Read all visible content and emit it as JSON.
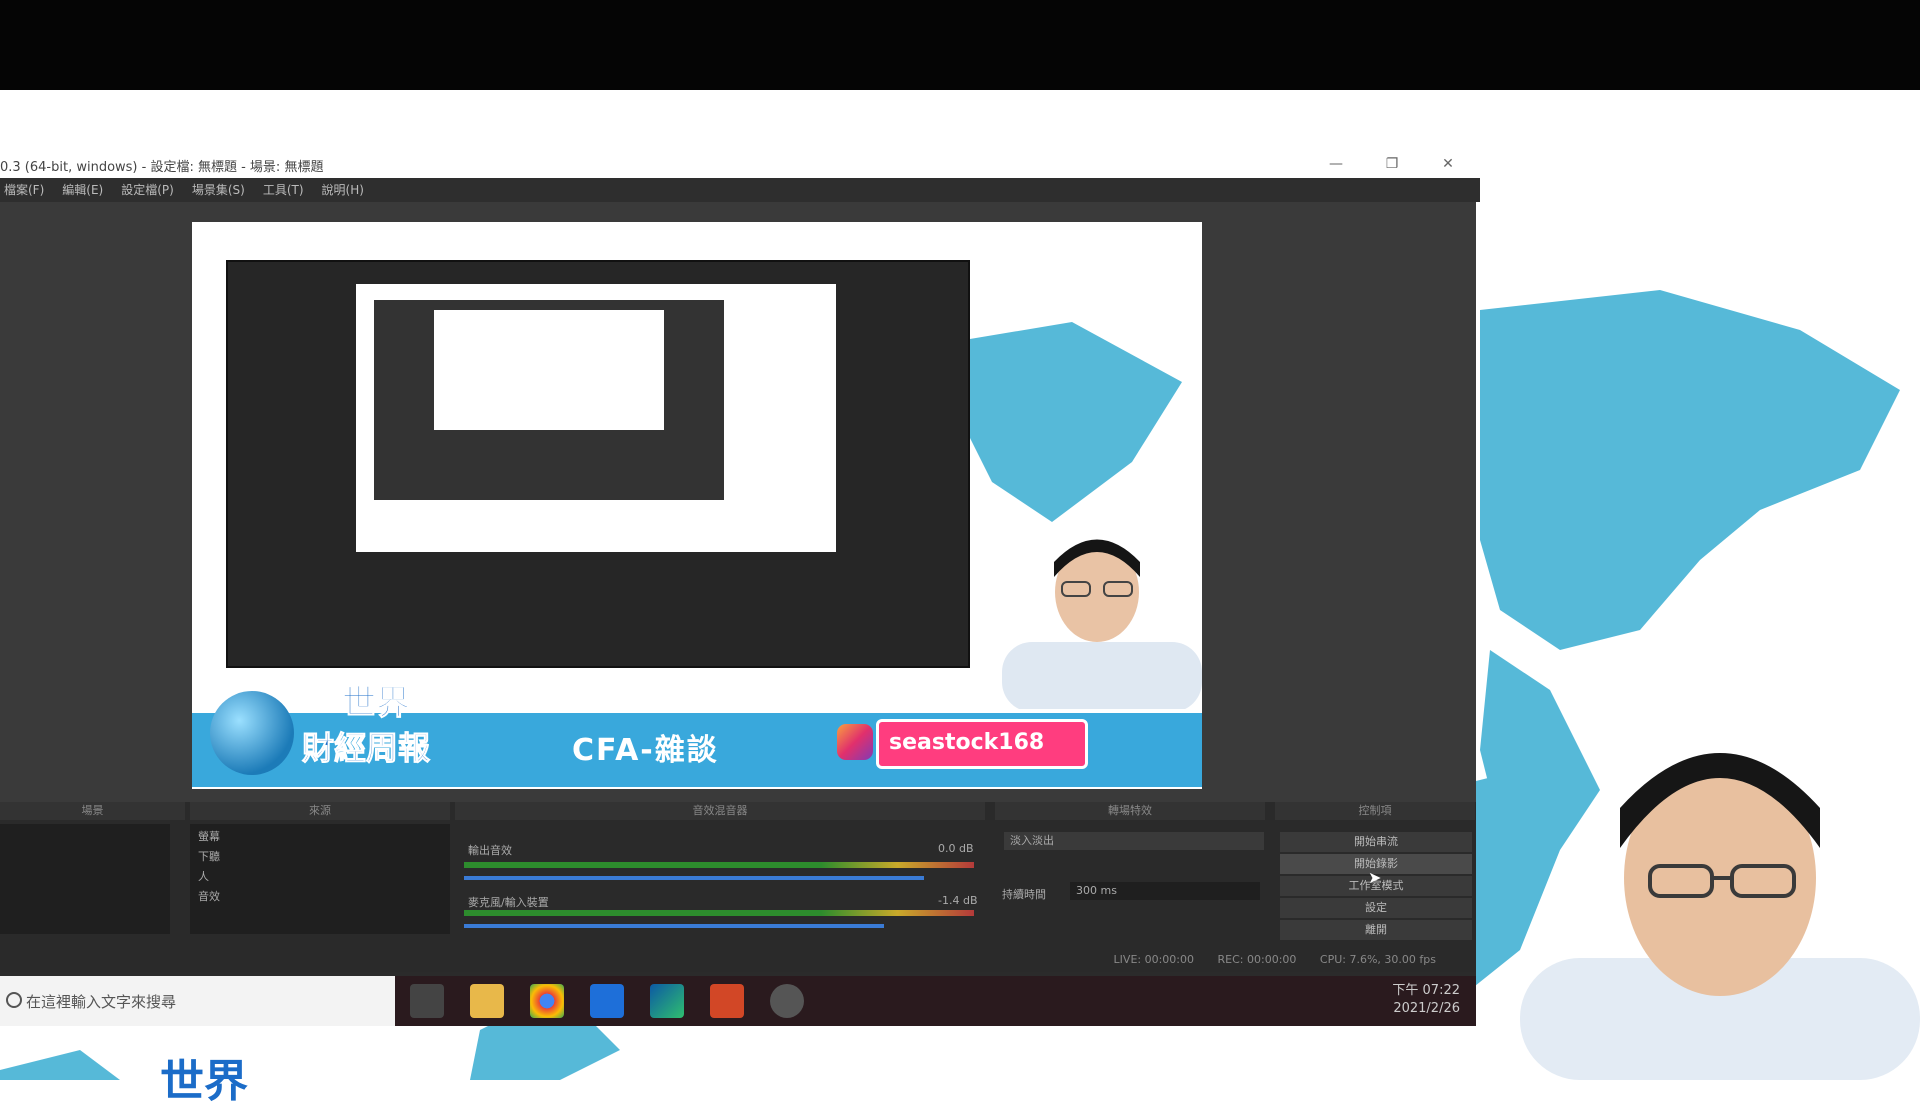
{
  "window": {
    "title": "0.3 (64-bit, windows) - 設定檔: 無標題 - 場景: 無標題",
    "menu": [
      "檔案(F)",
      "編輯(E)",
      "設定檔(P)",
      "場景集(S)",
      "工具(T)",
      "說明(H)"
    ]
  },
  "preview": {
    "brand_line1": "世界",
    "brand_line2": "財經周報",
    "course": "CFA-雜談",
    "instagram": "seastock168"
  },
  "dock": {
    "scenes_title": "場景",
    "sources_title": "來源",
    "mixer_title": "音效混音器",
    "transitions_title": "轉場特效",
    "controls_title": "控制項",
    "sources": [
      "螢幕",
      "下聽",
      "人",
      "音效"
    ],
    "mixer": [
      {
        "name": "輸出音效",
        "level_db": "0.0 dB"
      },
      {
        "name": "麥克風/輸入裝置",
        "level_db": "-1.4 dB"
      }
    ],
    "transition_value": "淡入淡出",
    "duration_label": "持續時間",
    "duration_value": "300 ms",
    "controls": [
      "開始串流",
      "開始錄影",
      "工作室模式",
      "設定",
      "離開"
    ]
  },
  "status": {
    "live": "LIVE: 00:00:00",
    "rec": "REC: 00:00:00",
    "cpu": "CPU: 7.6%, 30.00 fps"
  },
  "taskbar": {
    "search_placeholder": "在這裡輸入文字來搜尋",
    "time": "下午 07:22",
    "date": "2021/2/26"
  },
  "page_bottom": {
    "brand": "世界"
  }
}
